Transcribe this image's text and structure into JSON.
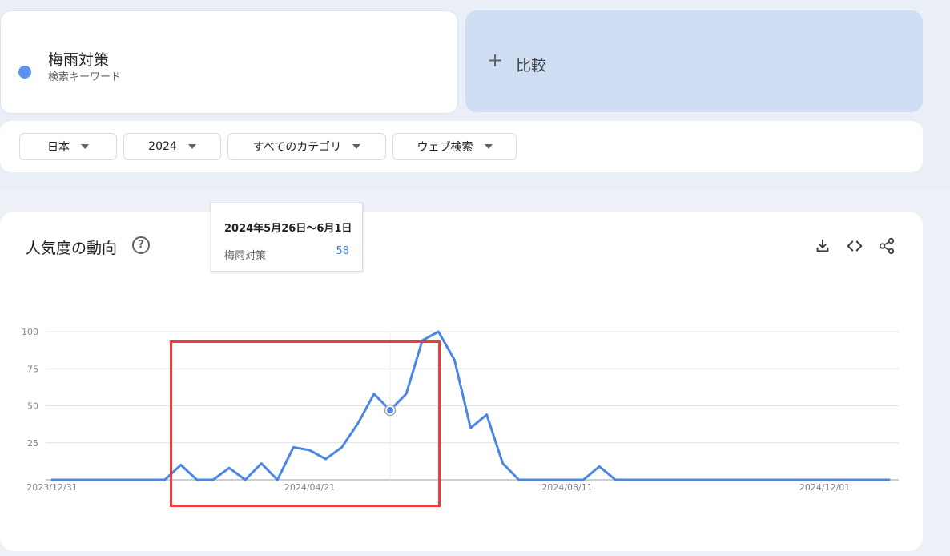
{
  "term": {
    "name": "梅雨対策",
    "subtitle": "検索キーワード",
    "color": "#5b91f5"
  },
  "compare": {
    "plus": "+",
    "label": "比較"
  },
  "filters": [
    {
      "label": "日本"
    },
    {
      "label": "2024"
    },
    {
      "label": "すべてのカテゴリ"
    },
    {
      "label": "ウェブ検索"
    }
  ],
  "chart_section": {
    "title": "人気度の動向",
    "help": "?",
    "icons": [
      "download-icon",
      "embed-code-icon",
      "share-icon"
    ]
  },
  "tooltip": {
    "date": "2024年5月26日〜6月1日",
    "term": "梅雨対策",
    "value": "58"
  },
  "chart_data": {
    "type": "line",
    "title": "人気度の動向",
    "xlabel": "",
    "ylabel": "",
    "y_ticks": [
      25,
      50,
      75,
      100
    ],
    "ylim": [
      0,
      100
    ],
    "x_tick_labels": [
      {
        "label": "2023/12/31",
        "index": 0
      },
      {
        "label": "2024/04/21",
        "index": 16
      },
      {
        "label": "2024/08/11",
        "index": 32
      },
      {
        "label": "2024/12/01",
        "index": 48
      }
    ],
    "x": [
      "2023-12-31",
      "2024-01-07",
      "2024-01-14",
      "2024-01-21",
      "2024-01-28",
      "2024-02-04",
      "2024-02-11",
      "2024-02-18",
      "2024-02-25",
      "2024-03-03",
      "2024-03-10",
      "2024-03-17",
      "2024-03-24",
      "2024-03-31",
      "2024-04-07",
      "2024-04-14",
      "2024-04-21",
      "2024-04-28",
      "2024-05-05",
      "2024-05-12",
      "2024-05-19",
      "2024-05-26",
      "2024-06-02",
      "2024-06-09",
      "2024-06-16",
      "2024-06-23",
      "2024-06-30",
      "2024-07-07",
      "2024-07-14",
      "2024-07-21",
      "2024-07-28",
      "2024-08-04",
      "2024-08-11",
      "2024-08-18",
      "2024-08-25",
      "2024-09-01",
      "2024-09-08",
      "2024-09-15",
      "2024-09-22",
      "2024-09-29",
      "2024-10-06",
      "2024-10-13",
      "2024-10-20",
      "2024-10-27",
      "2024-11-03",
      "2024-11-10",
      "2024-11-17",
      "2024-11-24",
      "2024-12-01",
      "2024-12-08",
      "2024-12-15",
      "2024-12-22",
      "2024-12-29"
    ],
    "series": [
      {
        "color": "#4a86e8",
        "values": [
          0,
          0,
          0,
          0,
          0,
          0,
          0,
          0,
          10,
          0,
          0,
          8,
          0,
          11,
          0,
          22,
          20,
          14,
          22,
          38,
          58,
          47,
          58,
          94,
          100,
          81,
          35,
          44,
          11,
          0,
          0,
          0,
          0,
          0,
          9,
          0,
          0,
          0,
          0,
          0,
          0,
          0,
          0,
          0,
          0,
          0,
          0,
          0,
          0,
          0,
          0,
          0,
          0,
          0
        ]
      }
    ],
    "highlight_index": 21,
    "grid": true
  }
}
